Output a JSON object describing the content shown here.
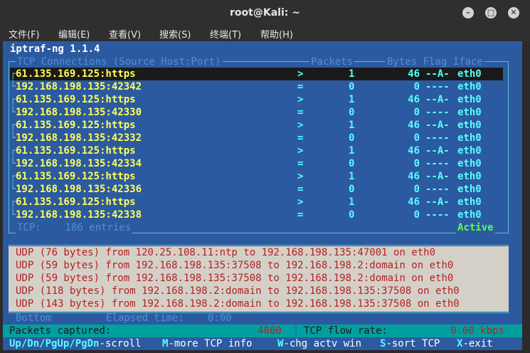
{
  "window": {
    "title": "root@Kali: ~"
  },
  "menu": [
    "文件(F)",
    "编辑(E)",
    "查看(V)",
    "搜索(S)",
    "终端(T)",
    "帮助(H)"
  ],
  "app_title": "iptraf-ng 1.1.4",
  "tcp_header": "TCP Connections (Source Host:Port)",
  "col_packets": "Packets",
  "col_bytes_flag_iface": "Bytes Flag Iface",
  "connections": [
    {
      "host": "61.135.169.125:https",
      "dir": ">",
      "packets": "1",
      "bytes": "46",
      "flag": "--A-",
      "iface": "eth0"
    },
    {
      "host": "192.168.198.135:42342",
      "dir": "=",
      "packets": "0",
      "bytes": "0",
      "flag": "----",
      "iface": "eth0"
    },
    {
      "host": "61.135.169.125:https",
      "dir": ">",
      "packets": "1",
      "bytes": "46",
      "flag": "--A-",
      "iface": "eth0"
    },
    {
      "host": "192.168.198.135:42330",
      "dir": "=",
      "packets": "0",
      "bytes": "0",
      "flag": "----",
      "iface": "eth0"
    },
    {
      "host": "61.135.169.125:https",
      "dir": ">",
      "packets": "1",
      "bytes": "46",
      "flag": "--A-",
      "iface": "eth0"
    },
    {
      "host": "192.168.198.135:42332",
      "dir": "=",
      "packets": "0",
      "bytes": "0",
      "flag": "----",
      "iface": "eth0"
    },
    {
      "host": "61.135.169.125:https",
      "dir": ">",
      "packets": "1",
      "bytes": "46",
      "flag": "--A-",
      "iface": "eth0"
    },
    {
      "host": "192.168.198.135:42334",
      "dir": "=",
      "packets": "0",
      "bytes": "0",
      "flag": "----",
      "iface": "eth0"
    },
    {
      "host": "61.135.169.125:https",
      "dir": ">",
      "packets": "1",
      "bytes": "46",
      "flag": "--A-",
      "iface": "eth0"
    },
    {
      "host": "192.168.198.135:42336",
      "dir": "=",
      "packets": "0",
      "bytes": "0",
      "flag": "----",
      "iface": "eth0"
    },
    {
      "host": "61.135.169.125:https",
      "dir": ">",
      "packets": "1",
      "bytes": "46",
      "flag": "--A-",
      "iface": "eth0"
    },
    {
      "host": "192.168.198.135:42338",
      "dir": "=",
      "packets": "0",
      "bytes": "0",
      "flag": "----",
      "iface": "eth0"
    }
  ],
  "tcp_footer": "TCP:    186 entries",
  "tcp_state": "Active",
  "udp_lines": [
    "UDP (76 bytes) from 120.25.108.11:ntp to 192.168.198.135:47001 on eth0",
    "UDP (59 bytes) from 192.168.198.135:37508 to 192.168.198.2:domain on eth0",
    "UDP (59 bytes) from 192.168.198.135:37508 to 192.168.198.2:domain on eth0",
    "UDP (118 bytes) from 192.168.198.2:domain to 192.168.198.135:37508 on eth0",
    "UDP (143 bytes) from 192.168.198.2:domain to 192.168.198.135:37508 on eth0"
  ],
  "bottom_label": "Bottom",
  "elapsed_label": "Elapsed time:",
  "elapsed_value": "0:00",
  "packets_captured_label": "Packets captured:",
  "packets_captured_value": "4860",
  "tcp_flow_label": "TCP flow rate:",
  "tcp_flow_value": "0.00 kbps",
  "keys": [
    {
      "key": "Up/Dn/PgUp/PgDn",
      "action": "-scroll"
    },
    {
      "key": "M",
      "action": "-more TCP info"
    },
    {
      "key": "W",
      "action": "-chg actv win"
    },
    {
      "key": "S",
      "action": "-sort TCP"
    },
    {
      "key": "X",
      "action": "-exit"
    }
  ],
  "colors": {
    "terminal_bg": "#2c5aa0",
    "host": "#ffff55",
    "stats": "#55ffff",
    "udp_text": "#b22222"
  }
}
